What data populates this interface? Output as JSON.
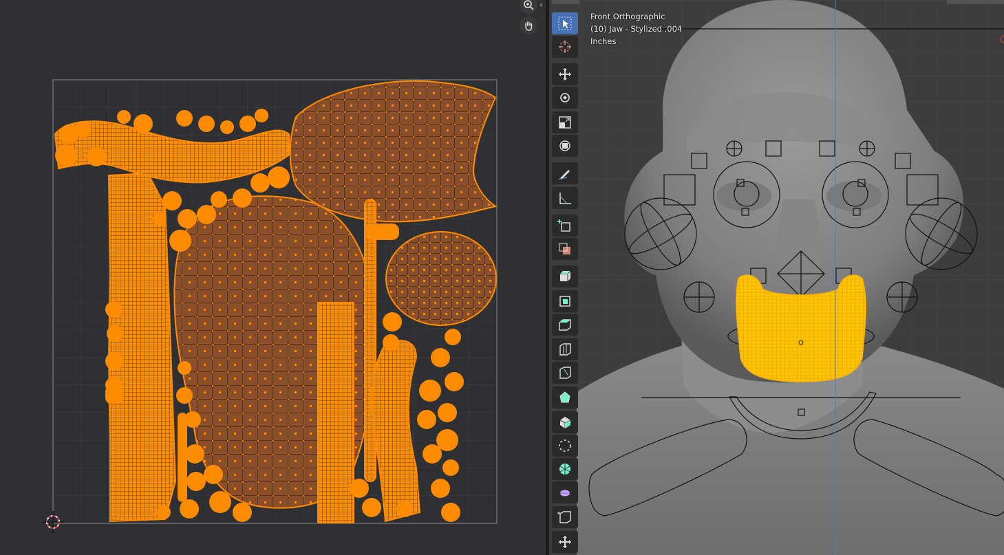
{
  "viewport": {
    "view_name": "Front Orthographic",
    "object_info": "(10) Jaw - Stylized .004",
    "units": "Inches"
  },
  "uv_editor": {
    "nav_zoom_icon": "zoom-icon",
    "nav_pan_icon": "pan-hand-icon"
  },
  "toolbar": {
    "tools": [
      "select-box-icon",
      "cursor-icon",
      "move-icon",
      "rotate-icon",
      "scale-icon",
      "transform-icon",
      "annotate-icon",
      "measure-icon",
      "add-cube-icon",
      "extrude-icon",
      "inset-icon",
      "bevel-icon",
      "loop-cut-icon",
      "knife-icon",
      "poly-build-icon",
      "spin-icon",
      "smooth-icon",
      "edge-slide-icon",
      "shrink-fatten-icon",
      "shear-icon",
      "rip-icon"
    ]
  },
  "colors": {
    "uv_selected": "#ff8c00",
    "uv_face": "#8a4f2a",
    "selection_mesh": "#ffc400",
    "active_tool": "#4772b3"
  }
}
